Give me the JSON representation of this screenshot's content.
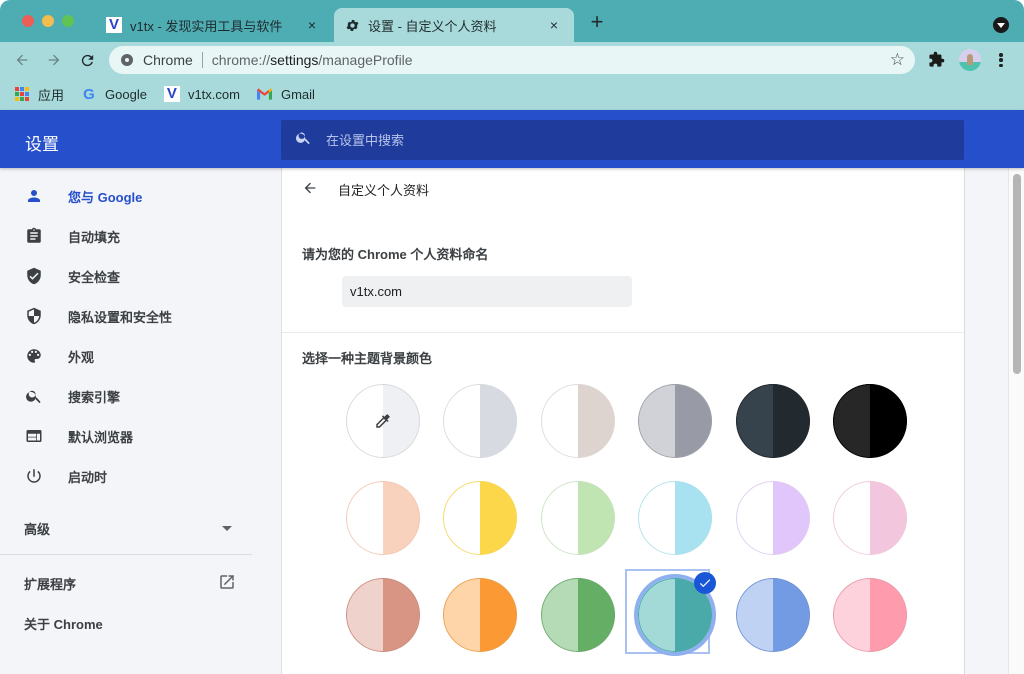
{
  "browser": {
    "tabs": [
      {
        "title": "v1tx - 发现实用工具与软件",
        "favicon": "v1tx-logo",
        "active": false
      },
      {
        "title": "设置 - 自定义个人资料",
        "favicon": "gear-icon",
        "active": true
      }
    ],
    "tab_close_glyph": "×",
    "new_tab_glyph": "+",
    "omnibox": {
      "chip": "Chrome",
      "url_prefix": "chrome://",
      "url_strong": "settings",
      "url_suffix": "/manageProfile"
    },
    "bookmarks": [
      {
        "label": "应用",
        "icon": "apps-grid-icon"
      },
      {
        "label": "Google",
        "icon": "google-icon"
      },
      {
        "label": "v1tx.com",
        "icon": "v1tx-logo"
      },
      {
        "label": "Gmail",
        "icon": "gmail-icon"
      }
    ],
    "favicon_v": "V",
    "google_g": "G",
    "star_glyph": "☆"
  },
  "settings": {
    "header_title": "设置",
    "search_placeholder": "在设置中搜索",
    "sidebar": {
      "items": [
        {
          "label": "您与 Google",
          "icon": "person-icon",
          "active": true
        },
        {
          "label": "自动填充",
          "icon": "clipboard-icon",
          "active": false
        },
        {
          "label": "安全检查",
          "icon": "shield-check-icon",
          "active": false
        },
        {
          "label": "隐私设置和安全性",
          "icon": "privacy-shield-icon",
          "active": false
        },
        {
          "label": "外观",
          "icon": "palette-icon",
          "active": false
        },
        {
          "label": "搜索引擎",
          "icon": "search-icon",
          "active": false
        },
        {
          "label": "默认浏览器",
          "icon": "browser-window-icon",
          "active": false
        },
        {
          "label": "启动时",
          "icon": "power-icon",
          "active": false
        }
      ],
      "advanced_label": "高级",
      "extensions_label": "扩展程序",
      "about_label": "关于 Chrome"
    },
    "page": {
      "title": "自定义个人资料",
      "name_label": "请为您的 Chrome 个人资料命名",
      "name_value": "v1tx.com",
      "color_label": "选择一种主题背景颜色",
      "selected_index": 15,
      "swatches": [
        {
          "name": "custom-color",
          "left": "#ffffff",
          "right": "#eef0f3",
          "border": "#d5d7db",
          "picker": true
        },
        {
          "name": "grey-default",
          "left": "#ffffff",
          "right": "#d7dae1",
          "border": "#d7dae1"
        },
        {
          "name": "warm-grey",
          "left": "#ffffff",
          "right": "#ddd3cf",
          "border": "#e0d8d5"
        },
        {
          "name": "grey",
          "left": "#d1d2d7",
          "right": "#989aa5",
          "border": "#9fa1ab"
        },
        {
          "name": "dark-slate",
          "left": "#36434d",
          "right": "#22292f",
          "border": "#22292f"
        },
        {
          "name": "black",
          "left": "#272727",
          "right": "#000000",
          "border": "#000000"
        },
        {
          "name": "peach",
          "left": "#ffffff",
          "right": "#f9d2be",
          "border": "#f2c7b2"
        },
        {
          "name": "yellow",
          "left": "#ffffff",
          "right": "#fdd74a",
          "border": "#f5d75d"
        },
        {
          "name": "light-green",
          "left": "#ffffff",
          "right": "#c0e4b2",
          "border": "#c8e2c0"
        },
        {
          "name": "light-cyan",
          "left": "#ffffff",
          "right": "#a8e1ef",
          "border": "#aee0ea"
        },
        {
          "name": "lavender",
          "left": "#ffffff",
          "right": "#e1c6fb",
          "border": "#e0cdef"
        },
        {
          "name": "pink",
          "left": "#ffffff",
          "right": "#f2c6dd",
          "border": "#efc9d8"
        },
        {
          "name": "terracotta",
          "left": "#efd2cb",
          "right": "#d99584",
          "border": "#c8907f"
        },
        {
          "name": "orange",
          "left": "#fed5a9",
          "right": "#fb9935",
          "border": "#e9a04f"
        },
        {
          "name": "green",
          "left": "#b4dbb5",
          "right": "#65ae65",
          "border": "#6ea86d"
        },
        {
          "name": "teal",
          "left": "#a3dad8",
          "right": "#4aa9a9",
          "border": "#4aa9a9"
        },
        {
          "name": "blue",
          "left": "#bfd2f4",
          "right": "#739be3",
          "border": "#7395d3"
        },
        {
          "name": "rose",
          "left": "#fdd2dd",
          "right": "#fe9cae",
          "border": "#ea9aa9"
        }
      ]
    }
  },
  "colors": {
    "accent": "#254fcb",
    "header_bg": "#254fcb",
    "search_bg": "#1f3c9c",
    "tabstrip": "#4eacb3",
    "toolbar": "#a8dadc",
    "selection_check": "#1a57d6"
  }
}
